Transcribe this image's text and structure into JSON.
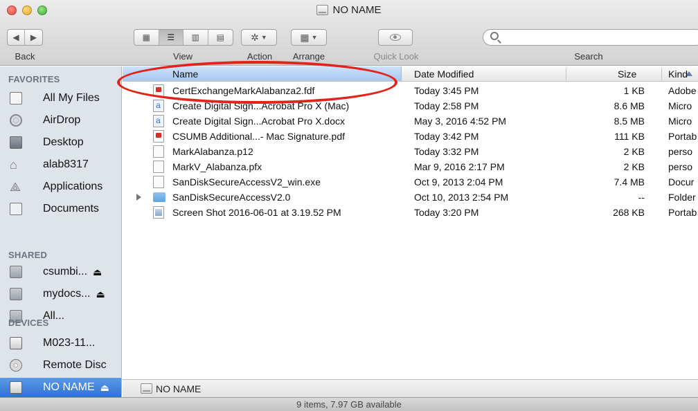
{
  "window": {
    "title": "NO NAME"
  },
  "toolbar": {
    "back_label": "Back",
    "view_label": "View",
    "action_label": "Action",
    "arrange_label": "Arrange",
    "quicklook_label": "Quick Look",
    "search_label": "Search",
    "search_value": ""
  },
  "sidebar": {
    "favorites_header": "FAVORITES",
    "favorites": [
      {
        "label": "All My Files",
        "icon": "all-files-icon"
      },
      {
        "label": "AirDrop",
        "icon": "airdrop-icon"
      },
      {
        "label": "Desktop",
        "icon": "desktop-icon"
      },
      {
        "label": "alab8317",
        "icon": "home-icon"
      },
      {
        "label": "Applications",
        "icon": "applications-icon"
      },
      {
        "label": "Documents",
        "icon": "documents-icon"
      }
    ],
    "shared_header": "SHARED",
    "shared": [
      {
        "label": "csumbi...",
        "icon": "network-computer-icon"
      },
      {
        "label": "mydocs...",
        "icon": "network-computer-icon"
      },
      {
        "label": "All...",
        "icon": "network-icon"
      }
    ],
    "devices_header": "DEVICES",
    "devices": [
      {
        "label": "M023-11...",
        "icon": "hard-drive-icon"
      },
      {
        "label": "Remote Disc",
        "icon": "disc-icon"
      },
      {
        "label": "NO NAME",
        "icon": "drive-icon",
        "selected": true
      }
    ],
    "eject_glyph": "⏏"
  },
  "columns": {
    "name": "Name",
    "date": "Date Modified",
    "size": "Size",
    "kind": "Kind"
  },
  "files": [
    {
      "name": "CertExchangeMarkAlabanza2.fdf",
      "date": "Today 3:45 PM",
      "size": "1 KB",
      "kind": "Adobe",
      "icon": "pdf-file-icon"
    },
    {
      "name": "Create Digital Sign...Acrobat Pro X (Mac)",
      "date": "Today 2:58 PM",
      "size": "8.6 MB",
      "kind": "Micro",
      "icon": "word-file-icon"
    },
    {
      "name": "Create Digital Sign...Acrobat Pro X.docx",
      "date": "May 3, 2016 4:52 PM",
      "size": "8.5 MB",
      "kind": "Micro",
      "icon": "word-file-icon"
    },
    {
      "name": "CSUMB Additional...- Mac Signature.pdf",
      "date": "Today 3:42 PM",
      "size": "111 KB",
      "kind": "Portab",
      "icon": "pdf-file-icon"
    },
    {
      "name": "MarkAlabanza.p12",
      "date": "Today 3:32 PM",
      "size": "2 KB",
      "kind": "perso",
      "icon": "generic-file-icon"
    },
    {
      "name": "MarkV_Alabanza.pfx",
      "date": "Mar 9, 2016 2:17 PM",
      "size": "2 KB",
      "kind": "perso",
      "icon": "generic-file-icon"
    },
    {
      "name": "SanDiskSecureAccessV2_win.exe",
      "date": "Oct 9, 2013 2:04 PM",
      "size": "7.4 MB",
      "kind": "Docur",
      "icon": "generic-file-icon"
    },
    {
      "name": "SanDiskSecureAccessV2.0",
      "date": "Oct 10, 2013 2:54 PM",
      "size": "--",
      "kind": "Folder",
      "icon": "folder-icon"
    },
    {
      "name": "Screen Shot 2016-06-01 at 3.19.52 PM",
      "date": "Today 3:20 PM",
      "size": "268 KB",
      "kind": "Portab",
      "icon": "image-file-icon"
    }
  ],
  "pathbar": {
    "label": "NO NAME"
  },
  "status": {
    "text": "9 items, 7.97 GB available"
  },
  "colors": {
    "selection": "#2f72d4",
    "sidebar_bg": "#dfe4ea",
    "annotation_red": "#e2231a"
  }
}
